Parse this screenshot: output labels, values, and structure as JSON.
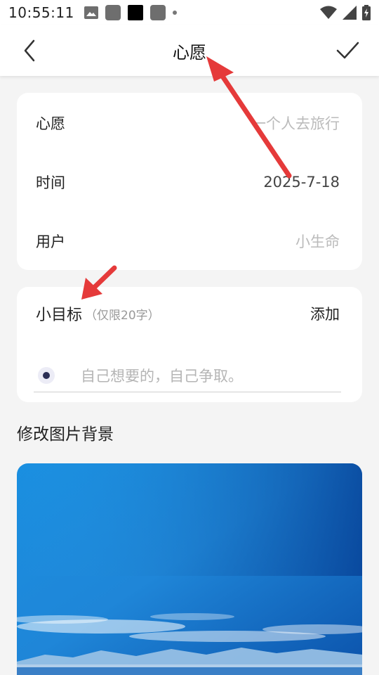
{
  "status_bar": {
    "time": "10:55:11"
  },
  "header": {
    "title": "心愿"
  },
  "info_card": {
    "rows": [
      {
        "label": "心愿",
        "value": "一个人去旅行"
      },
      {
        "label": "时间",
        "value": "2025-7-18"
      },
      {
        "label": "用户",
        "value": "小生命"
      }
    ]
  },
  "goal_card": {
    "title": "小目标",
    "hint": "（仅限20字）",
    "add_label": "添加",
    "item_placeholder": "自己想要的，自己争取。"
  },
  "background_section": {
    "title": "修改图片背景"
  },
  "colors": {
    "accent_arrow": "#e53a3a",
    "card_background": "#ffffff",
    "page_background": "#f4f4f4"
  }
}
